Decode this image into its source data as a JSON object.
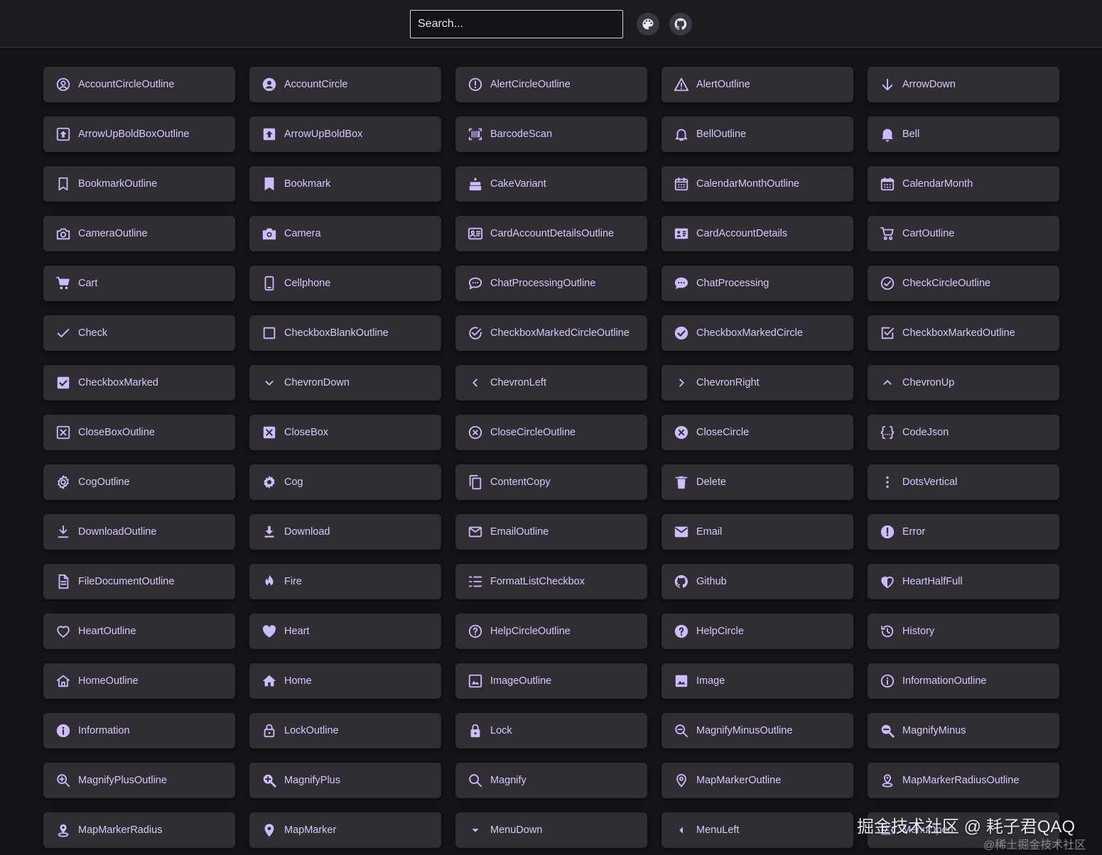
{
  "header": {
    "search_placeholder": "Search...",
    "buttons": [
      {
        "name": "palette-icon"
      },
      {
        "name": "github-icon"
      }
    ]
  },
  "colors": {
    "background": "#141218",
    "header": "#1d1b22",
    "card": "#302d35",
    "icon": "#cdbcf7",
    "text": "#d6c9f8"
  },
  "icons": [
    {
      "label": "AccountCircleOutline",
      "icon": "account-circle-outline-icon"
    },
    {
      "label": "AccountCircle",
      "icon": "account-circle-icon"
    },
    {
      "label": "AlertCircleOutline",
      "icon": "alert-circle-outline-icon"
    },
    {
      "label": "AlertOutline",
      "icon": "alert-outline-icon"
    },
    {
      "label": "ArrowDown",
      "icon": "arrow-down-icon"
    },
    {
      "label": "ArrowUpBoldBoxOutline",
      "icon": "arrow-up-bold-box-outline-icon"
    },
    {
      "label": "ArrowUpBoldBox",
      "icon": "arrow-up-bold-box-icon"
    },
    {
      "label": "BarcodeScan",
      "icon": "barcode-scan-icon"
    },
    {
      "label": "BellOutline",
      "icon": "bell-outline-icon"
    },
    {
      "label": "Bell",
      "icon": "bell-icon"
    },
    {
      "label": "BookmarkOutline",
      "icon": "bookmark-outline-icon"
    },
    {
      "label": "Bookmark",
      "icon": "bookmark-icon"
    },
    {
      "label": "CakeVariant",
      "icon": "cake-variant-icon"
    },
    {
      "label": "CalendarMonthOutline",
      "icon": "calendar-month-outline-icon"
    },
    {
      "label": "CalendarMonth",
      "icon": "calendar-month-icon"
    },
    {
      "label": "CameraOutline",
      "icon": "camera-outline-icon"
    },
    {
      "label": "Camera",
      "icon": "camera-icon"
    },
    {
      "label": "CardAccountDetailsOutline",
      "icon": "card-account-details-outline-icon"
    },
    {
      "label": "CardAccountDetails",
      "icon": "card-account-details-icon"
    },
    {
      "label": "CartOutline",
      "icon": "cart-outline-icon"
    },
    {
      "label": "Cart",
      "icon": "cart-icon"
    },
    {
      "label": "Cellphone",
      "icon": "cellphone-icon"
    },
    {
      "label": "ChatProcessingOutline",
      "icon": "chat-processing-outline-icon"
    },
    {
      "label": "ChatProcessing",
      "icon": "chat-processing-icon"
    },
    {
      "label": "CheckCircleOutline",
      "icon": "check-circle-outline-icon"
    },
    {
      "label": "Check",
      "icon": "check-icon"
    },
    {
      "label": "CheckboxBlankOutline",
      "icon": "checkbox-blank-outline-icon"
    },
    {
      "label": "CheckboxMarkedCircleOutline",
      "icon": "checkbox-marked-circle-outline-icon"
    },
    {
      "label": "CheckboxMarkedCircle",
      "icon": "checkbox-marked-circle-icon"
    },
    {
      "label": "CheckboxMarkedOutline",
      "icon": "checkbox-marked-outline-icon"
    },
    {
      "label": "CheckboxMarked",
      "icon": "checkbox-marked-icon"
    },
    {
      "label": "ChevronDown",
      "icon": "chevron-down-icon"
    },
    {
      "label": "ChevronLeft",
      "icon": "chevron-left-icon"
    },
    {
      "label": "ChevronRight",
      "icon": "chevron-right-icon"
    },
    {
      "label": "ChevronUp",
      "icon": "chevron-up-icon"
    },
    {
      "label": "CloseBoxOutline",
      "icon": "close-box-outline-icon"
    },
    {
      "label": "CloseBox",
      "icon": "close-box-icon"
    },
    {
      "label": "CloseCircleOutline",
      "icon": "close-circle-outline-icon"
    },
    {
      "label": "CloseCircle",
      "icon": "close-circle-icon"
    },
    {
      "label": "CodeJson",
      "icon": "code-json-icon"
    },
    {
      "label": "CogOutline",
      "icon": "cog-outline-icon"
    },
    {
      "label": "Cog",
      "icon": "cog-icon"
    },
    {
      "label": "ContentCopy",
      "icon": "content-copy-icon"
    },
    {
      "label": "Delete",
      "icon": "delete-icon"
    },
    {
      "label": "DotsVertical",
      "icon": "dots-vertical-icon"
    },
    {
      "label": "DownloadOutline",
      "icon": "download-outline-icon"
    },
    {
      "label": "Download",
      "icon": "download-icon"
    },
    {
      "label": "EmailOutline",
      "icon": "email-outline-icon"
    },
    {
      "label": "Email",
      "icon": "email-icon"
    },
    {
      "label": "Error",
      "icon": "error-icon"
    },
    {
      "label": "FileDocumentOutline",
      "icon": "file-document-outline-icon"
    },
    {
      "label": "Fire",
      "icon": "fire-icon"
    },
    {
      "label": "FormatListCheckbox",
      "icon": "format-list-checkbox-icon"
    },
    {
      "label": "Github",
      "icon": "github-icon"
    },
    {
      "label": "HeartHalfFull",
      "icon": "heart-half-full-icon"
    },
    {
      "label": "HeartOutline",
      "icon": "heart-outline-icon"
    },
    {
      "label": "Heart",
      "icon": "heart-icon"
    },
    {
      "label": "HelpCircleOutline",
      "icon": "help-circle-outline-icon"
    },
    {
      "label": "HelpCircle",
      "icon": "help-circle-icon"
    },
    {
      "label": "History",
      "icon": "history-icon"
    },
    {
      "label": "HomeOutline",
      "icon": "home-outline-icon"
    },
    {
      "label": "Home",
      "icon": "home-icon"
    },
    {
      "label": "ImageOutline",
      "icon": "image-outline-icon"
    },
    {
      "label": "Image",
      "icon": "image-icon"
    },
    {
      "label": "InformationOutline",
      "icon": "information-outline-icon"
    },
    {
      "label": "Information",
      "icon": "information-icon"
    },
    {
      "label": "LockOutline",
      "icon": "lock-outline-icon"
    },
    {
      "label": "Lock",
      "icon": "lock-icon"
    },
    {
      "label": "MagnifyMinusOutline",
      "icon": "magnify-minus-outline-icon"
    },
    {
      "label": "MagnifyMinus",
      "icon": "magnify-minus-icon"
    },
    {
      "label": "MagnifyPlusOutline",
      "icon": "magnify-plus-outline-icon"
    },
    {
      "label": "MagnifyPlus",
      "icon": "magnify-plus-icon"
    },
    {
      "label": "Magnify",
      "icon": "magnify-icon"
    },
    {
      "label": "MapMarkerOutline",
      "icon": "map-marker-outline-icon"
    },
    {
      "label": "MapMarkerRadiusOutline",
      "icon": "map-marker-radius-outline-icon"
    },
    {
      "label": "MapMarkerRadius",
      "icon": "map-marker-radius-icon"
    },
    {
      "label": "MapMarker",
      "icon": "map-marker-icon"
    },
    {
      "label": "MenuDown",
      "icon": "menu-down-icon"
    },
    {
      "label": "MenuLeft",
      "icon": "menu-left-icon"
    },
    {
      "label": "MenuOpen",
      "icon": "menu-open-icon"
    }
  ],
  "watermark": {
    "main": "掘金技术社区 @ 耗子君QAQ",
    "sub": "@稀土掘金技术社区"
  }
}
